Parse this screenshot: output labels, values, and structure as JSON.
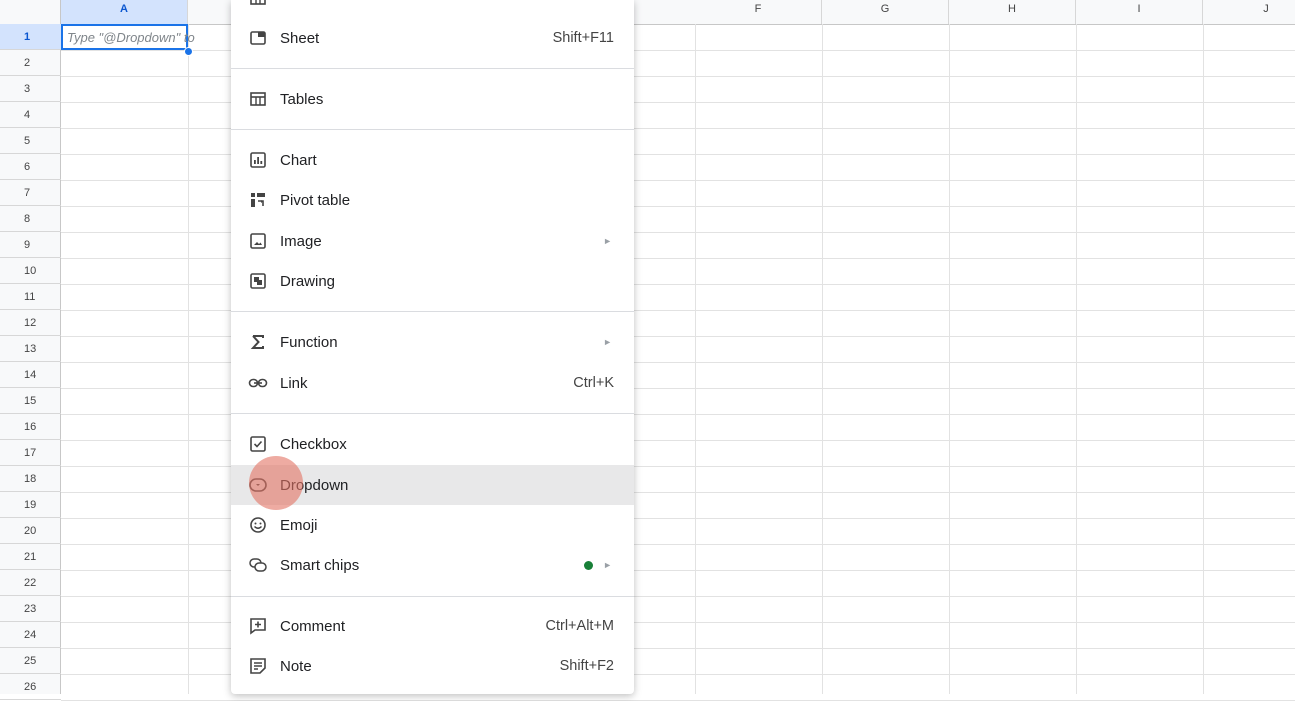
{
  "grid": {
    "columns": [
      "A",
      "",
      "",
      "",
      "",
      "F",
      "G",
      "H",
      "I",
      "J"
    ],
    "rows": [
      "1",
      "2",
      "3",
      "4",
      "5",
      "6",
      "7",
      "8",
      "9",
      "10",
      "11",
      "12",
      "13",
      "14",
      "15",
      "16",
      "17",
      "18",
      "19",
      "20",
      "21",
      "22",
      "23",
      "24",
      "25",
      "26"
    ],
    "a1_hint": "Type \"@Dropdown\" to"
  },
  "menu": {
    "items": [
      {
        "label": "Sheet",
        "shortcut": "Shift+F11",
        "icon": "sheet-icon"
      },
      {
        "label": "Tables",
        "shortcut": "",
        "icon": "table-icon"
      },
      {
        "label": "Chart",
        "shortcut": "",
        "icon": "chart-icon"
      },
      {
        "label": "Pivot table",
        "shortcut": "",
        "icon": "pivot-table-icon"
      },
      {
        "label": "Image",
        "shortcut": "",
        "icon": "image-icon",
        "submenu": true
      },
      {
        "label": "Drawing",
        "shortcut": "",
        "icon": "drawing-icon"
      },
      {
        "label": "Function",
        "shortcut": "",
        "icon": "sigma-icon",
        "submenu": true
      },
      {
        "label": "Link",
        "shortcut": "Ctrl+K",
        "icon": "link-icon"
      },
      {
        "label": "Checkbox",
        "shortcut": "",
        "icon": "checkbox-icon"
      },
      {
        "label": "Dropdown",
        "shortcut": "",
        "icon": "dropdown-icon",
        "hovered": true
      },
      {
        "label": "Emoji",
        "shortcut": "",
        "icon": "emoji-icon"
      },
      {
        "label": "Smart chips",
        "shortcut": "",
        "icon": "smart-chips-icon",
        "submenu": true,
        "new_dot": true
      },
      {
        "label": "Comment",
        "shortcut": "Ctrl+Alt+M",
        "icon": "comment-icon"
      },
      {
        "label": "Note",
        "shortcut": "Shift+F2",
        "icon": "note-icon"
      }
    ],
    "submenu_arrow": "►"
  },
  "colors": {
    "accent": "#1a73e8",
    "hover": "#e8e8e9",
    "dot": "#188038"
  }
}
